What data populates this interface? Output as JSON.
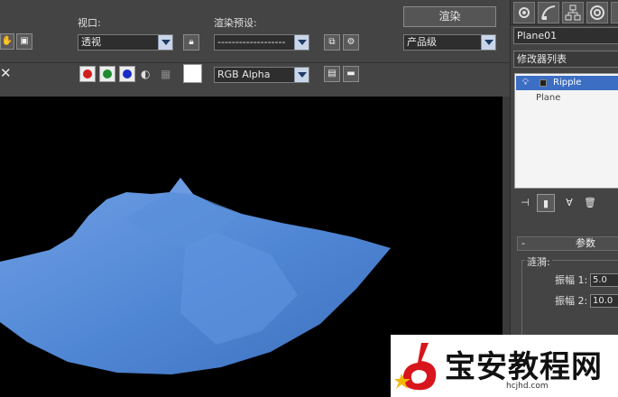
{
  "toolbar": {
    "viewport_label": "视口:",
    "viewport_value": "透视",
    "preset_label": "渲染预设:",
    "preset_value": "-------------------",
    "render_button": "渲染",
    "quality_value": "产品级",
    "channel_value": "RGB Alpha",
    "close_glyph": "✕"
  },
  "colors": {
    "red_channel": "#d21e1e",
    "green_channel": "#1c8c2c",
    "blue_channel": "#1c2cc8",
    "mesh_fill": "#4f86d4",
    "viewport_bg": "#000000"
  },
  "command_panel": {
    "object_name": "Plane01",
    "modifier_list": "修改器列表",
    "stack": [
      {
        "label": "Ripple",
        "selected": true
      },
      {
        "label": "Plane",
        "selected": false
      }
    ],
    "rollout_title": "参数",
    "rollout_toggle": "-",
    "group_label": "涟漪:",
    "amplitude1_label": "振幅 1:",
    "amplitude1_value": "5.0",
    "amplitude2_label": "振幅 2:",
    "amplitude2_value": "10.0"
  },
  "watermark": {
    "title": "宝安教程网",
    "url": "hcjhd.com"
  }
}
